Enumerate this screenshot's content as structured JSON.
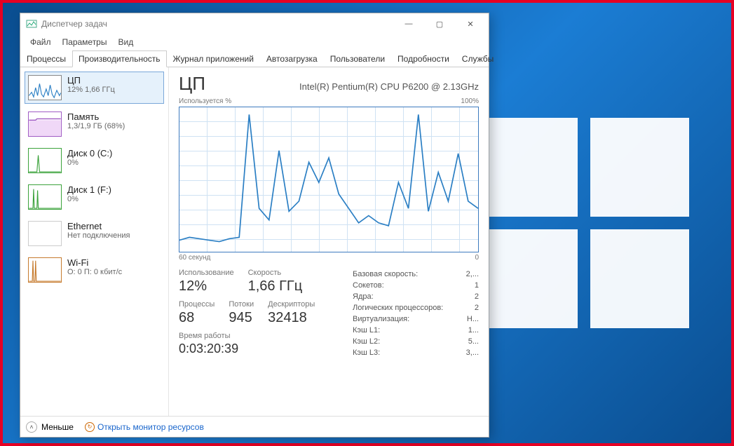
{
  "window": {
    "title": "Диспетчер задач"
  },
  "menu": {
    "file": "Файл",
    "options": "Параметры",
    "view": "Вид"
  },
  "tabs": [
    "Процессы",
    "Производительность",
    "Журнал приложений",
    "Автозагрузка",
    "Пользователи",
    "Подробности",
    "Службы"
  ],
  "sidebar": [
    {
      "title": "ЦП",
      "sub": "12% 1,66 ГГц"
    },
    {
      "title": "Память",
      "sub": "1,3/1,9 ГБ (68%)"
    },
    {
      "title": "Диск 0 (C:)",
      "sub": "0%"
    },
    {
      "title": "Диск 1 (F:)",
      "sub": "0%"
    },
    {
      "title": "Ethernet",
      "sub": "Нет подключения"
    },
    {
      "title": "Wi-Fi",
      "sub": "О: 0 П: 0 кбит/с"
    }
  ],
  "main": {
    "heading": "ЦП",
    "model": "Intel(R) Pentium(R) CPU P6200 @ 2.13GHz",
    "chart_top_left": "Используется %",
    "chart_top_right": "100%",
    "chart_bot_left": "60 секунд",
    "chart_bot_right": "0"
  },
  "stats": {
    "usage_label": "Использование",
    "usage": "12%",
    "speed_label": "Скорость",
    "speed": "1,66 ГГц",
    "proc_label": "Процессы",
    "proc": "68",
    "threads_label": "Потоки",
    "threads": "945",
    "handles_label": "Дескрипторы",
    "handles": "32418",
    "uptime_label": "Время работы",
    "uptime": "0:03:20:39",
    "right": [
      {
        "k": "Базовая скорость:",
        "v": "2,..."
      },
      {
        "k": "Сокетов:",
        "v": "1"
      },
      {
        "k": "Ядра:",
        "v": "2"
      },
      {
        "k": "Логических процессоров:",
        "v": "2"
      },
      {
        "k": "Виртуализация:",
        "v": "Н..."
      },
      {
        "k": "Кэш L1:",
        "v": "1..."
      },
      {
        "k": "Кэш L2:",
        "v": "5..."
      },
      {
        "k": "Кэш L3:",
        "v": "3,..."
      }
    ]
  },
  "status": {
    "less": "Меньше",
    "link": "Открыть монитор ресурсов"
  },
  "chart_data": {
    "type": "line",
    "title": "ЦП — Используется %",
    "xlabel": "секунд назад",
    "ylabel": "%",
    "ylim": [
      0,
      100
    ],
    "xlim": [
      60,
      0
    ],
    "x": [
      60,
      58,
      56,
      54,
      52,
      50,
      48,
      46,
      44,
      42,
      40,
      38,
      36,
      34,
      32,
      30,
      28,
      26,
      24,
      22,
      20,
      18,
      16,
      14,
      12,
      10,
      8,
      6,
      4,
      2,
      0
    ],
    "values": [
      8,
      10,
      9,
      8,
      7,
      9,
      10,
      95,
      30,
      22,
      70,
      28,
      35,
      62,
      48,
      65,
      40,
      30,
      20,
      25,
      20,
      18,
      48,
      30,
      95,
      28,
      55,
      35,
      68,
      35,
      30
    ]
  }
}
